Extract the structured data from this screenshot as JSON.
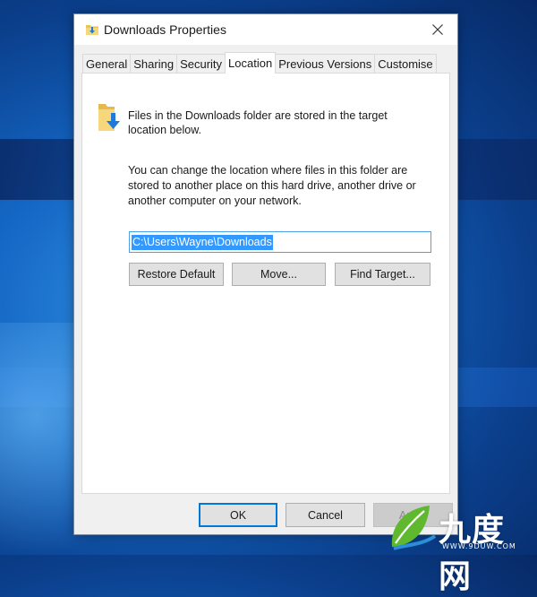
{
  "window": {
    "title": "Downloads Properties",
    "title_icon": "downloads-folder-icon",
    "close_icon": "close-icon"
  },
  "tabs": [
    {
      "label": "General",
      "active": false
    },
    {
      "label": "Sharing",
      "active": false
    },
    {
      "label": "Security",
      "active": false
    },
    {
      "label": "Location",
      "active": true
    },
    {
      "label": "Previous Versions",
      "active": false
    },
    {
      "label": "Customise",
      "active": false
    }
  ],
  "location": {
    "description": "Files in the Downloads folder are stored in the target location below.",
    "change_text": "You can change the location where files in this folder are stored to another place on this hard drive, another drive or another computer on your network.",
    "path_value": "C:\\Users\\Wayne\\Downloads",
    "restore_default_label": "Restore Default",
    "move_label": "Move...",
    "find_target_label": "Find Target..."
  },
  "footer": {
    "ok_label": "OK",
    "cancel_label": "Cancel",
    "apply_label": "Apply"
  },
  "watermark": {
    "text": "九度网",
    "url": "WWW.9DUW.COM"
  },
  "colors": {
    "accent": "#0078d7",
    "selection": "#3399ff",
    "desktop": "#1466c4"
  }
}
